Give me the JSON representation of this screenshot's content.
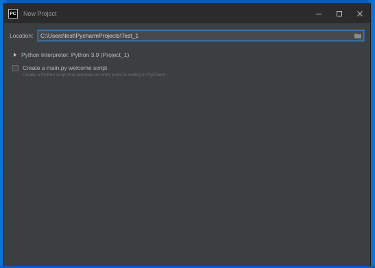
{
  "window": {
    "title": "New Project",
    "app_icon_text": "PC"
  },
  "controls": {
    "minimize": "—",
    "maximize": "☐",
    "close": "✕"
  },
  "form": {
    "location_label": "Location:",
    "location_value": "C:\\Users\\test\\PycharmProjects\\Test_1",
    "interpreter_label": "Python Interpreter: Python 3.9 (Project_1)",
    "welcome_checkbox_label": "Create a main.py welcome script",
    "welcome_checkbox_checked": false,
    "welcome_description": "Create a Python script that provides an entry point to coding in PyCharm."
  },
  "icons": {
    "folder": "folder-icon",
    "expand": "triangle-right-icon"
  }
}
